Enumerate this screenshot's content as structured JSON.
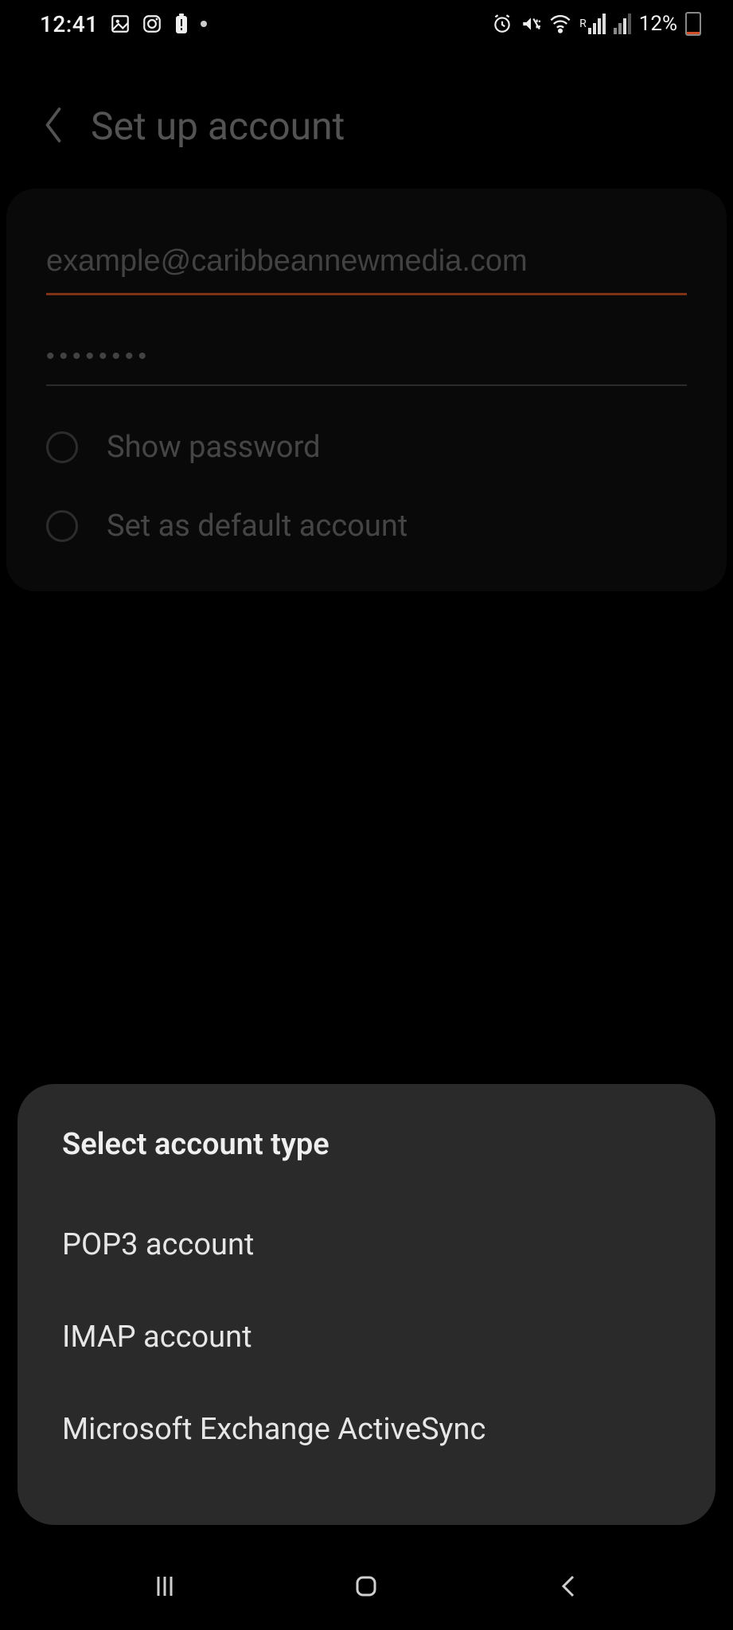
{
  "status_bar": {
    "time": "12:41",
    "battery_text": "12%"
  },
  "header": {
    "title": "Set up account"
  },
  "form": {
    "email_value": "example@caribbeannewmedia.com",
    "password_value": "••••••••",
    "show_password_label": "Show password",
    "set_default_label": "Set as default account"
  },
  "sheet": {
    "title": "Select account type",
    "options": [
      "POP3 account",
      "IMAP account",
      "Microsoft Exchange ActiveSync"
    ]
  }
}
